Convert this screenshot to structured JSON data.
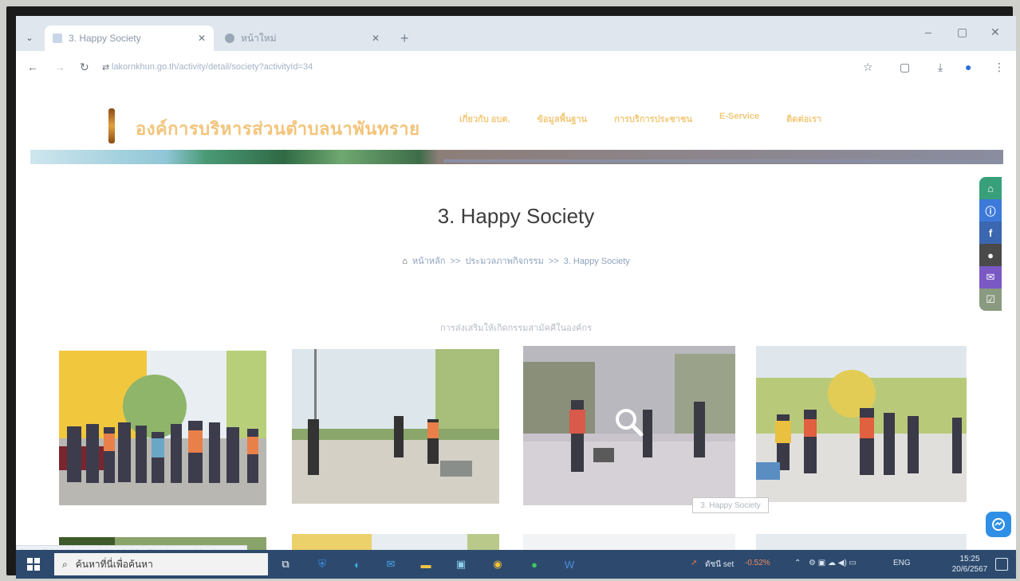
{
  "browser": {
    "tabs": [
      {
        "title": "3. Happy Society",
        "active": true
      },
      {
        "title": "หน้าใหม่",
        "active": false
      }
    ],
    "new_tab_symbol": "+",
    "tab_close_symbol": "✕",
    "tab_list_symbol": "⌄",
    "window_controls": {
      "minimize": "–",
      "maximize": "▢",
      "close": "✕"
    },
    "url": "lakornkhun.go.th/activity/detail/society?activityId=34"
  },
  "site": {
    "name": "องค์การบริหารส่วนตำบลนาพันทราย",
    "nav": [
      "เกี่ยวกับ อบต.",
      "ข้อมูลพื้นฐาน",
      "การบริการประชาชน",
      "E-Service",
      "ติดต่อเรา"
    ]
  },
  "page": {
    "title": "3. Happy Society",
    "breadcrumb": {
      "home": "หน้าหลัก",
      "sep": ">>",
      "level2": "ประมวลภาพกิจกรรม",
      "current": "3. Happy Society"
    },
    "section_caption": "การส่งเสริมให้เกิดกรรมสามัคคีในองค์กร",
    "hover_tooltip": "3. Happy Society",
    "status_url": "https://lakornkhun.go.th/activity/detail/society?activityId=34"
  },
  "sidebar": {
    "buttons": [
      {
        "name": "home",
        "symbol": "⌂",
        "color": "#37a07a"
      },
      {
        "name": "info",
        "symbol": "ⓘ",
        "color": "#3c79d9"
      },
      {
        "name": "facebook",
        "symbol": "f",
        "color": "#3b66b0"
      },
      {
        "name": "person",
        "symbol": "●",
        "color": "#4a4a4a"
      },
      {
        "name": "mail",
        "symbol": "✉",
        "color": "#7a59c4"
      },
      {
        "name": "check",
        "symbol": "☑",
        "color": "#8a9a80"
      }
    ]
  },
  "taskbar": {
    "search_placeholder": "ค้นหาที่นี่เพื่อค้นหา",
    "stock_label": "ดัชนี set",
    "stock_change": "-0.52%",
    "language": "ENG",
    "time": "15:25",
    "date": "20/6/2567"
  },
  "colors": {
    "accent_gold": "#f1c979",
    "breadcrumb_blue": "#8fa2bb",
    "taskbar": "#2d4a6e",
    "chat": "#2f8fe6"
  }
}
